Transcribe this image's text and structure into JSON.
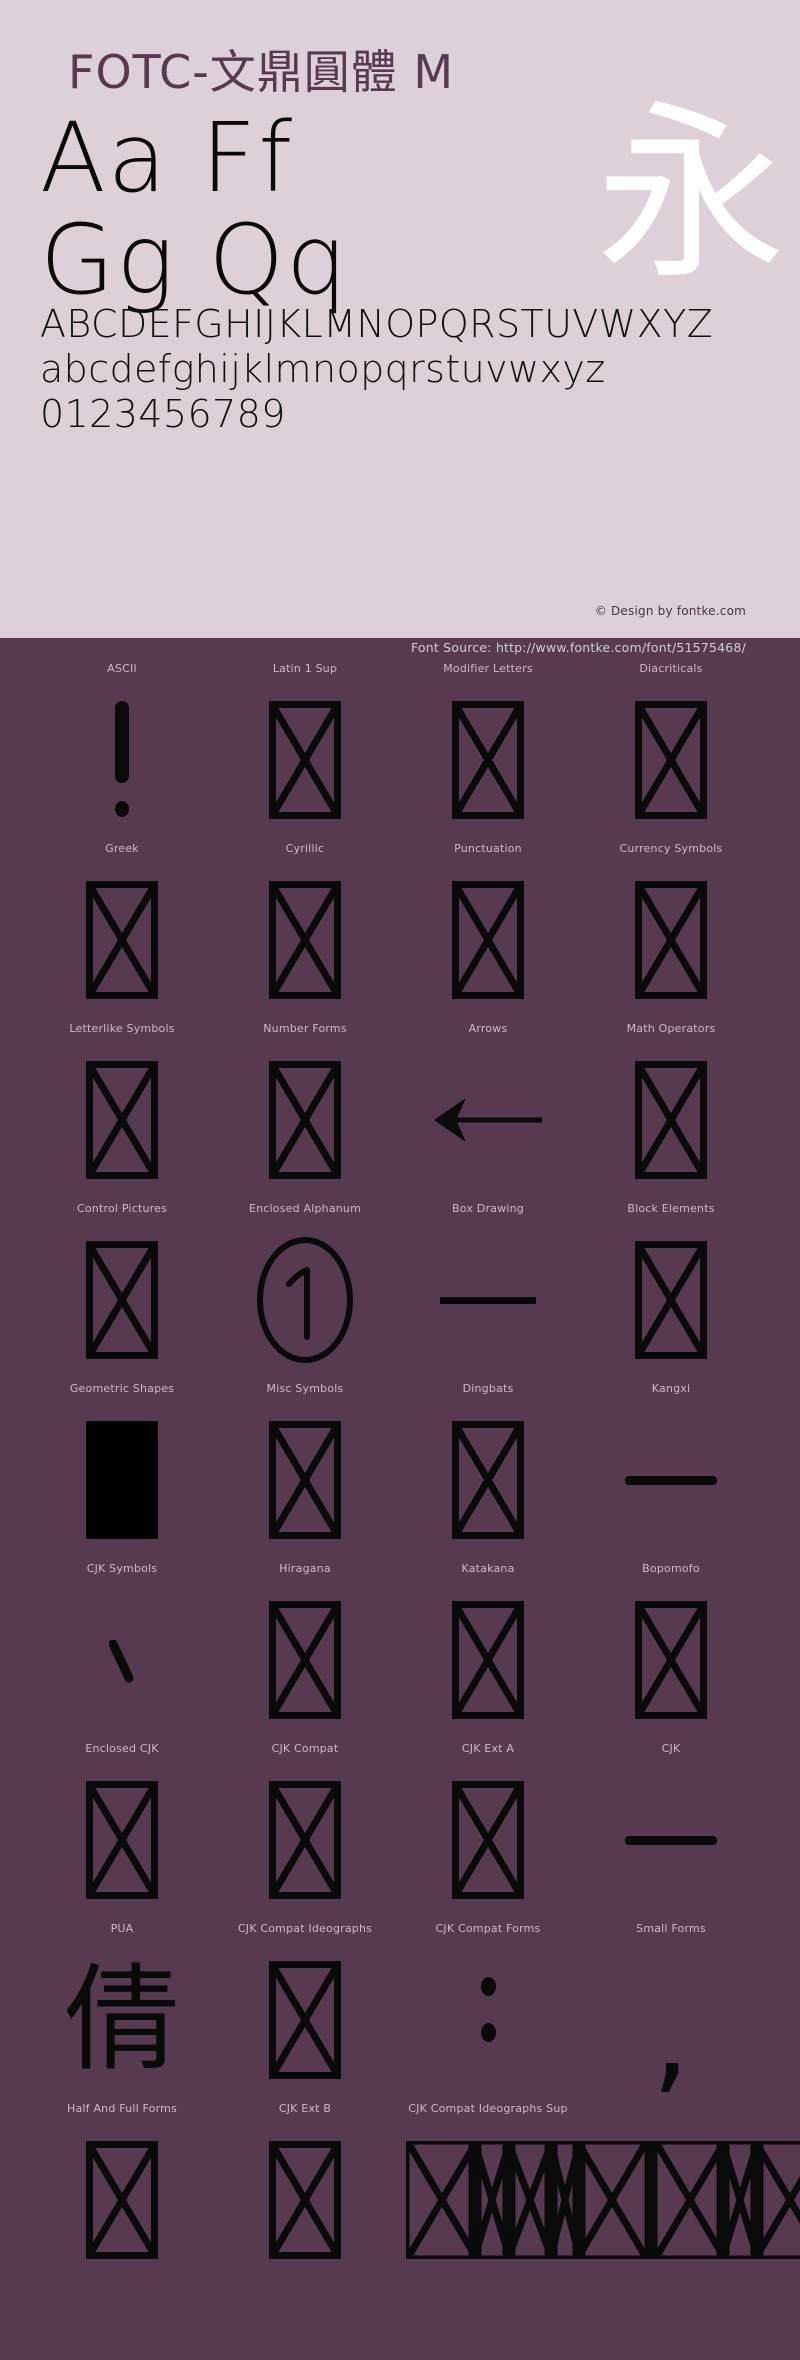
{
  "banner": {
    "title": "FOTC-文鼎圓體 M",
    "pair_row_1": "Aa    Ff",
    "pair_row_2": "Gg    Qq",
    "cjk_sample": "永",
    "alphabet_upper": "ABCDEFGHIJKLMNOPQRSTUVWXYZ",
    "alphabet_lower": "abcdefghijklmnopqrstuvwxyz",
    "digits": "0123456789",
    "design_credit": "© Design by fontke.com",
    "bg_color": "#ded0d8",
    "title_color": "#573a50"
  },
  "source": {
    "text": "Font Source: http://www.fontke.com/font/51575468/",
    "bg_color": "#573a50",
    "text_color": "#d8c9d4"
  },
  "grid": {
    "rows": [
      {
        "cells": [
          {
            "label": "ASCII",
            "art": "exclamation",
            "glyph": "!"
          },
          {
            "label": "Latin 1 Sup",
            "art": "tofu"
          },
          {
            "label": "Modifier Letters",
            "art": "tofu"
          },
          {
            "label": "Diacriticals",
            "art": "tofu"
          }
        ]
      },
      {
        "cells": [
          {
            "label": "Greek",
            "art": "tofu"
          },
          {
            "label": "Cyrillic",
            "art": "tofu"
          },
          {
            "label": "Punctuation",
            "art": "tofu"
          },
          {
            "label": "Currency Symbols",
            "art": "tofu"
          }
        ]
      },
      {
        "cells": [
          {
            "label": "Letterlike Symbols",
            "art": "tofu"
          },
          {
            "label": "Number Forms",
            "art": "tofu"
          },
          {
            "label": "Arrows",
            "art": "arrow-left",
            "glyph": "←"
          },
          {
            "label": "Math Operators",
            "art": "tofu"
          }
        ]
      },
      {
        "cells": [
          {
            "label": "Control Pictures",
            "art": "tofu"
          },
          {
            "label": "Enclosed Alphanum",
            "art": "circled-one",
            "glyph": "①"
          },
          {
            "label": "Box Drawing",
            "art": "hbar",
            "glyph": "─"
          },
          {
            "label": "Block Elements",
            "art": "tofu"
          }
        ]
      },
      {
        "cells": [
          {
            "label": "Geometric Shapes",
            "art": "block-fill",
            "glyph": "█"
          },
          {
            "label": "Misc Symbols",
            "art": "tofu"
          },
          {
            "label": "Dingbats",
            "art": "tofu"
          },
          {
            "label": "Kangxi",
            "art": "hbar-rounded",
            "glyph": "⼀"
          }
        ]
      },
      {
        "cells": [
          {
            "label": "CJK Symbols",
            "art": "tick",
            "glyph": "、"
          },
          {
            "label": "Hiragana",
            "art": "tofu"
          },
          {
            "label": "Katakana",
            "art": "tofu"
          },
          {
            "label": "Bopomofo",
            "art": "tofu"
          }
        ]
      },
      {
        "cells": [
          {
            "label": "Enclosed CJK",
            "art": "tofu"
          },
          {
            "label": "CJK Compat",
            "art": "tofu"
          },
          {
            "label": "CJK Ext A",
            "art": "tofu"
          },
          {
            "label": "CJK",
            "art": "hbar-rounded",
            "glyph": "一"
          }
        ]
      },
      {
        "cells": [
          {
            "label": "PUA",
            "art": "glyph-cjk",
            "glyph": "倩"
          },
          {
            "label": "CJK Compat Ideographs",
            "art": "tofu"
          },
          {
            "label": "CJK Compat Forms",
            "art": "colon",
            "glyph": "︓"
          },
          {
            "label": "Small Forms",
            "art": "comma",
            "glyph": ","
          }
        ]
      },
      {
        "cells": [
          {
            "label": "Half And Full Forms",
            "art": "tofu"
          },
          {
            "label": "CJK Ext B",
            "art": "tofu"
          },
          {
            "label": "CJK Compat Ideographs Sup",
            "art": "tofu-wide"
          },
          {
            "label": "",
            "art": "none"
          }
        ]
      }
    ]
  },
  "colors": {
    "page_bg": "#573a50",
    "banner_bg": "#ded0d8",
    "glyph_black": "#0a0a0a",
    "label_gray": "#cdb9c7",
    "accent_white": "#ffffff"
  }
}
